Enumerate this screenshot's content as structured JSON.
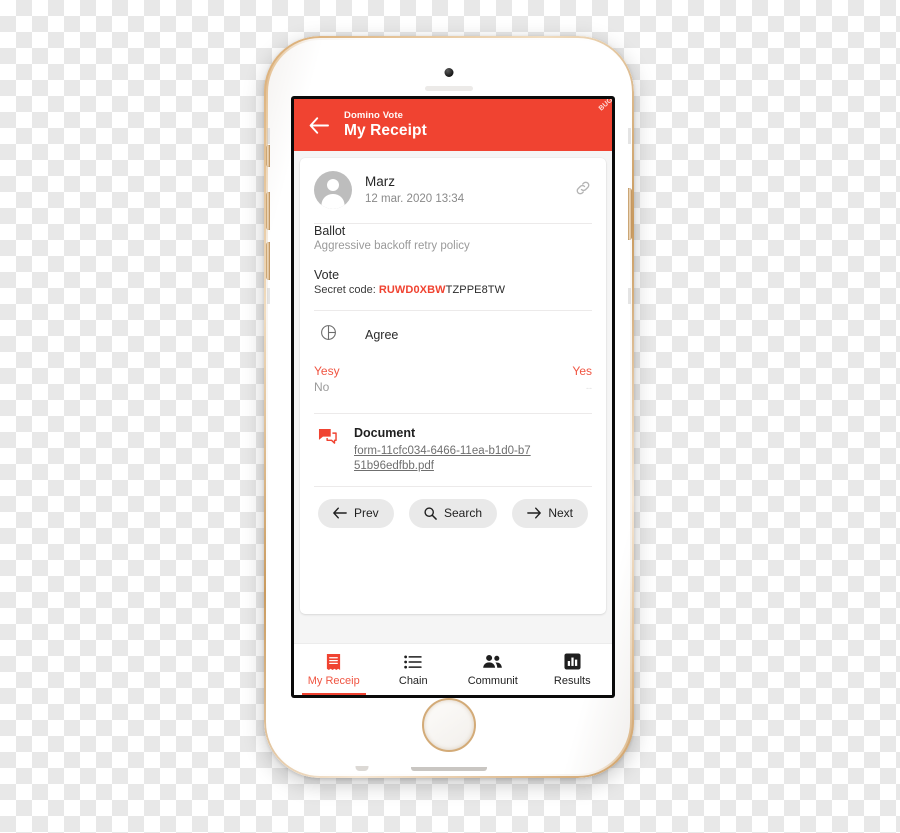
{
  "theme": {
    "accent": "#F04331",
    "accent_light": "#F05542",
    "screen_bg": "#f5f5f5",
    "card_bg": "#ffffff",
    "muted_text": "#9a9a9a"
  },
  "appbar": {
    "subtitle": "Domino Vote",
    "title": "My Receipt",
    "back_icon": "back-arrow-icon",
    "ribbon_label": "BUG"
  },
  "receipt": {
    "user": {
      "name": "Marz",
      "date": "12 mar. 2020 13:34",
      "avatar_icon": "person-avatar-icon",
      "link_icon": "link-icon"
    },
    "ballot": {
      "title": "Ballot",
      "description": "Aggressive backoff retry policy"
    },
    "vote": {
      "title": "Vote",
      "secret_label": "Secret code: ",
      "secret_code_highlight": "RUWD0XBW",
      "secret_code_rest": "TZPPE8TW"
    },
    "question": {
      "icon": "pie-chart-icon",
      "text": "Agree",
      "options": [
        {
          "label": "Yesy",
          "value": "Yes",
          "selected": true
        },
        {
          "label": "No",
          "value": "--",
          "selected": false
        }
      ]
    },
    "document": {
      "icon": "comment-bubbles-icon",
      "title": "Document",
      "filename": "form-11cfc034-6466-11ea-b1d0-b751b96edfbb.pdf"
    },
    "actions": [
      {
        "label": "Prev",
        "icon": "arrow-left-icon"
      },
      {
        "label": "Search",
        "icon": "search-icon"
      },
      {
        "label": "Next",
        "icon": "arrow-right-icon"
      }
    ]
  },
  "bottom_nav": {
    "items": [
      {
        "label": "My Receip",
        "icon": "receipt-icon",
        "active": true
      },
      {
        "label": "Chain",
        "icon": "list-icon",
        "active": false
      },
      {
        "label": "Communit",
        "icon": "people-icon",
        "active": false
      },
      {
        "label": "Results",
        "icon": "bar-chart-icon",
        "active": false
      }
    ]
  }
}
